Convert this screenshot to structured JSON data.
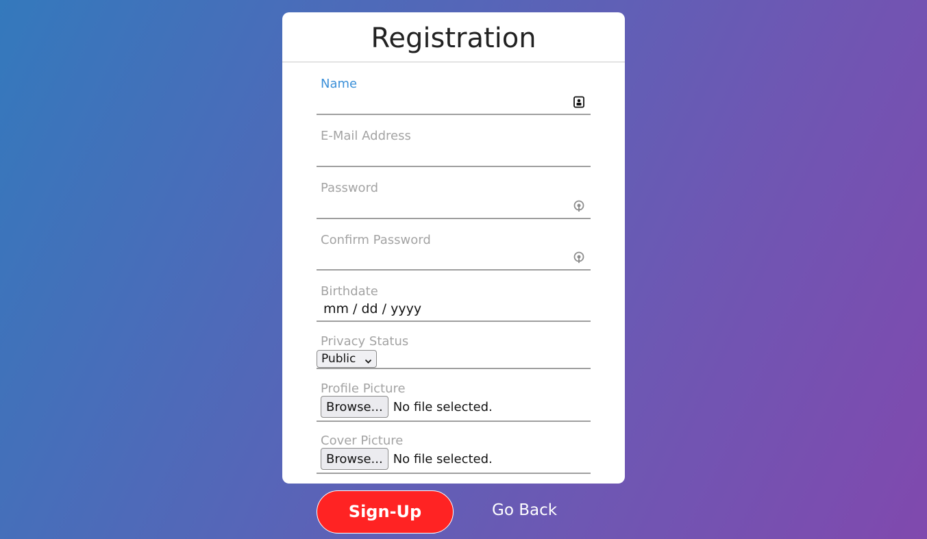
{
  "form": {
    "title": "Registration",
    "fields": {
      "name": {
        "label": "Name",
        "value": ""
      },
      "email": {
        "label": "E-Mail Address",
        "value": ""
      },
      "password": {
        "label": "Password",
        "value": ""
      },
      "confirm_password": {
        "label": "Confirm Password",
        "value": ""
      },
      "birthdate": {
        "label": "Birthdate",
        "value": "mm / dd / yyyy"
      },
      "privacy": {
        "label": "Privacy Status",
        "value": "Public"
      },
      "profile_picture": {
        "label": "Profile Picture",
        "button": "Browse...",
        "status": "No file selected."
      },
      "cover_picture": {
        "label": "Cover Picture",
        "button": "Browse...",
        "status": "No file selected."
      }
    }
  },
  "actions": {
    "signup_label": "Sign-Up",
    "goback_label": "Go Back"
  },
  "colors": {
    "accent_label": "#3a8fd8",
    "signup_bg": "#ff2323",
    "gradient_start": "#3479bc",
    "gradient_end": "#8049ae"
  },
  "icons": {
    "name_field": "contact-card-icon",
    "password_field": "key-icon",
    "confirm_password_field": "key-icon",
    "privacy_select": "chevron-down-icon"
  }
}
